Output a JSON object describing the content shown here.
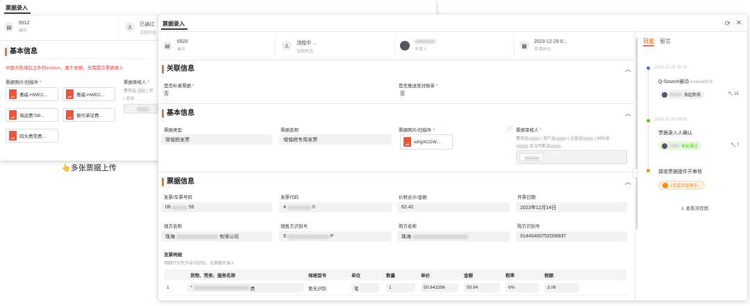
{
  "back_window": {
    "tab_title": "票据录入",
    "stats": [
      {
        "value": "6912",
        "label": "编号"
      },
      {
        "value": "已通过",
        "label": "流程状态"
      }
    ],
    "section_title": "基本信息",
    "warning": "中国大陆境区之外的invoice，属于收据，无需提交票据录入",
    "attach_label": "票据照片/扫描件",
    "approver_label": "票据审核人",
    "approver_text": "费用选",
    "approver_text2": "| 无法",
    "files": [
      "惠威-HWEC...",
      "惠威-HWEC...",
      "海运费788...",
      "报代单证费...",
      "码头费克费..."
    ]
  },
  "caption": "👆多张票据上传",
  "front": {
    "tab_title": "票据录入",
    "stats": [
      {
        "value": "6920",
        "label": "编号"
      },
      {
        "value": "流程中 ...",
        "label": "流程状态"
      },
      {
        "value": "",
        "label": "申请人"
      },
      {
        "value": "2023-12-29 0...",
        "label": "申请时间"
      }
    ],
    "related": {
      "title": "关联信息",
      "f1_label": "是否补录票据",
      "f1_value": "否",
      "f2_label": "是否推送至对账单",
      "f2_value": "否"
    },
    "basic": {
      "title": "基本信息",
      "type_label": "票据类型",
      "type_value": "增值税发票",
      "name_label": "票据名称",
      "name_value": "增值税专用发票",
      "attach_label": "票据照片/扫描件",
      "attach_file": "wKgACGW...",
      "approver_label": "票据审核人",
      "approver_line1a": "费用选",
      "approver_line1b": "| 资产选",
      "approver_line1c": "| 运营选",
      "approver_line1d": "| 材料选",
      "approver_line2": "| 无法判断选"
    },
    "invoice": {
      "title": "票据信息",
      "fields": [
        {
          "label": "发票/车票号码",
          "value": "08",
          "value2": "56"
        },
        {
          "label": "发票代码",
          "value": "4",
          "value2": "0"
        },
        {
          "label": "价税合计/金额",
          "value": "62.42"
        },
        {
          "label": "开票日期",
          "value": "2023年12月14日"
        },
        {
          "label": "销方名称",
          "value": "珠海",
          "value2": "有限公司"
        },
        {
          "label": "销售方识别号",
          "value": "9",
          "value2": "P"
        },
        {
          "label": "购方名称",
          "value": "珠海"
        },
        {
          "label": "购方识别号",
          "value": "91440400752006837"
        }
      ],
      "detail_title": "发票明细",
      "detail_hint": "明细行为先字自动识别，无需额外录入",
      "columns": [
        "货物、劳务、服务名称",
        "规格型号",
        "单位",
        "数量",
        "单价",
        "金额",
        "税率",
        "税额"
      ],
      "row": {
        "no": "1",
        "name": "*",
        "name2": "费",
        "spec": "暂无识别",
        "unit": "笔",
        "qty": "1",
        "price": "50.943396",
        "amount": "50.94",
        "rate": "6%",
        "tax": "3.06"
      }
    },
    "side": {
      "tabs": [
        "日志",
        "留言"
      ],
      "timeline": [
        {
          "date": "2023-12-29 09:25",
          "title": "Q-Source被动",
          "sub": "invoiceOCR",
          "pill": "发起新商",
          "count": "15"
        },
        {
          "date": "2023-12-29 09:25",
          "title": "票据录入人确认",
          "pill": "非长通过",
          "count": "7"
        },
        {
          "date": "",
          "title": "接收票据提件开审核",
          "pill": "1态成员处理中..."
        }
      ],
      "flow_link": "查看流程图"
    },
    "colors": {
      "accent": "#e8743b",
      "green": "#52c41a",
      "orange": "#fa8c16",
      "blue": "#4a6fd8"
    }
  }
}
